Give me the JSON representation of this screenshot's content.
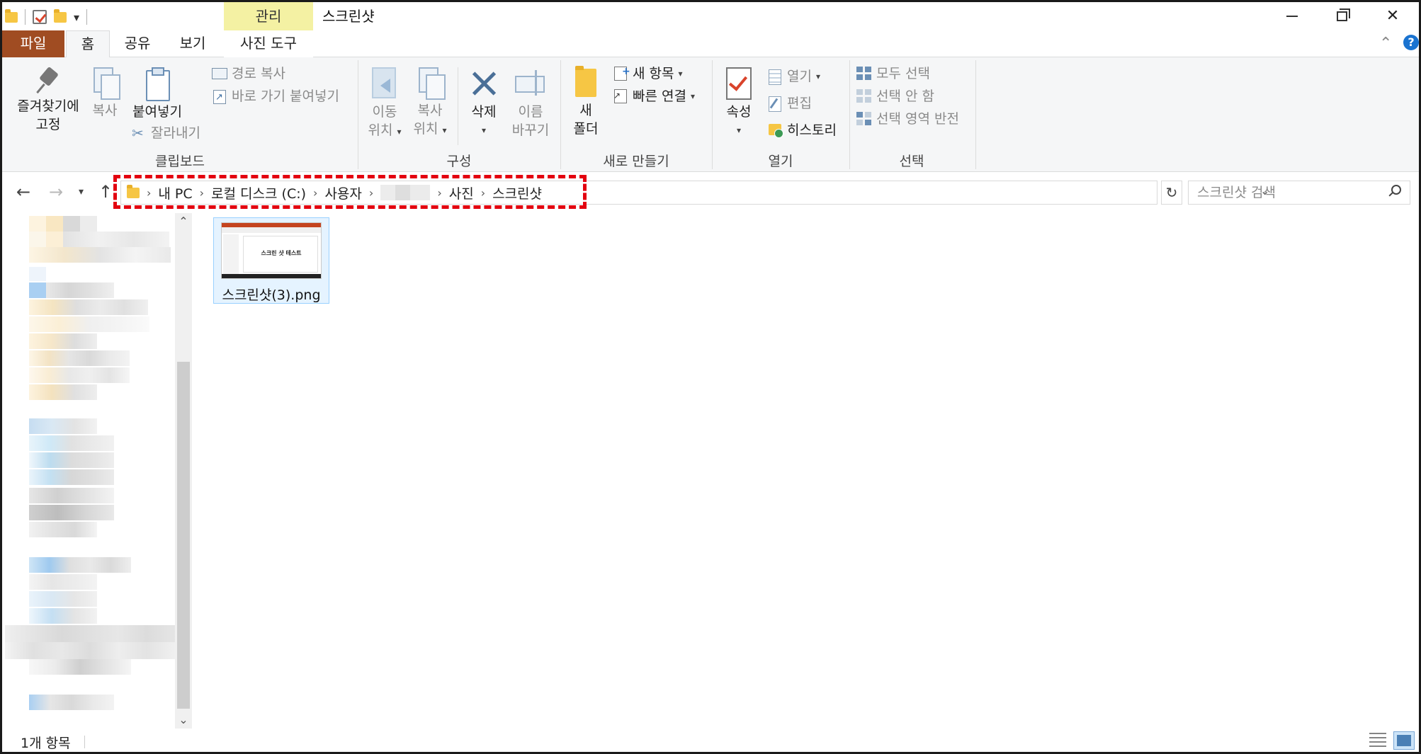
{
  "window": {
    "title": "스크린샷",
    "context_tab": "관리",
    "controls": {
      "minimize": "minimize",
      "maximize": "restore",
      "close": "✕"
    }
  },
  "tabs": {
    "file": "파일",
    "home": "홈",
    "share": "공유",
    "view": "보기",
    "picture_tools": "사진 도구",
    "help": "?"
  },
  "ribbon": {
    "clipboard": {
      "label": "클립보드",
      "pin": "즐겨찾기에",
      "pin2": "고정",
      "copy": "복사",
      "paste": "붙여넣기",
      "copy_path": "경로 복사",
      "paste_shortcut": "바로 가기 붙여넣기",
      "cut": "잘라내기"
    },
    "organize": {
      "label": "구성",
      "move": "이동",
      "move2": "위치",
      "copyto": "복사",
      "copyto2": "위치",
      "delete": "삭제",
      "rename": "이름",
      "rename2": "바꾸기"
    },
    "new": {
      "label": "새로 만들기",
      "new_folder": "새",
      "new_folder2": "폴더",
      "new_item": "새 항목",
      "easy_access": "빠른 연결"
    },
    "open": {
      "label": "열기",
      "properties": "속성",
      "open": "열기",
      "edit": "편집",
      "history": "히스토리"
    },
    "select": {
      "label": "선택",
      "select_all": "모두 선택",
      "select_none": "선택 안 함",
      "invert": "선택 영역 반전"
    }
  },
  "address": {
    "crumbs": [
      "내 PC",
      "로컬 디스크 (C:)",
      "사용자",
      "사진",
      "스크린샷"
    ],
    "search_placeholder": "스크린샷 검색"
  },
  "files": [
    {
      "name": "스크린샷(3).png",
      "thumb_text": "스크린 샷 테스트"
    }
  ],
  "status": {
    "count": "1개 항목"
  },
  "colors": {
    "file_tab": "#a04c22",
    "context_tab": "#f4f1a3",
    "highlight_dash": "#e3000f",
    "selection": "#e5f3ff",
    "accent": "#1a73d0"
  }
}
